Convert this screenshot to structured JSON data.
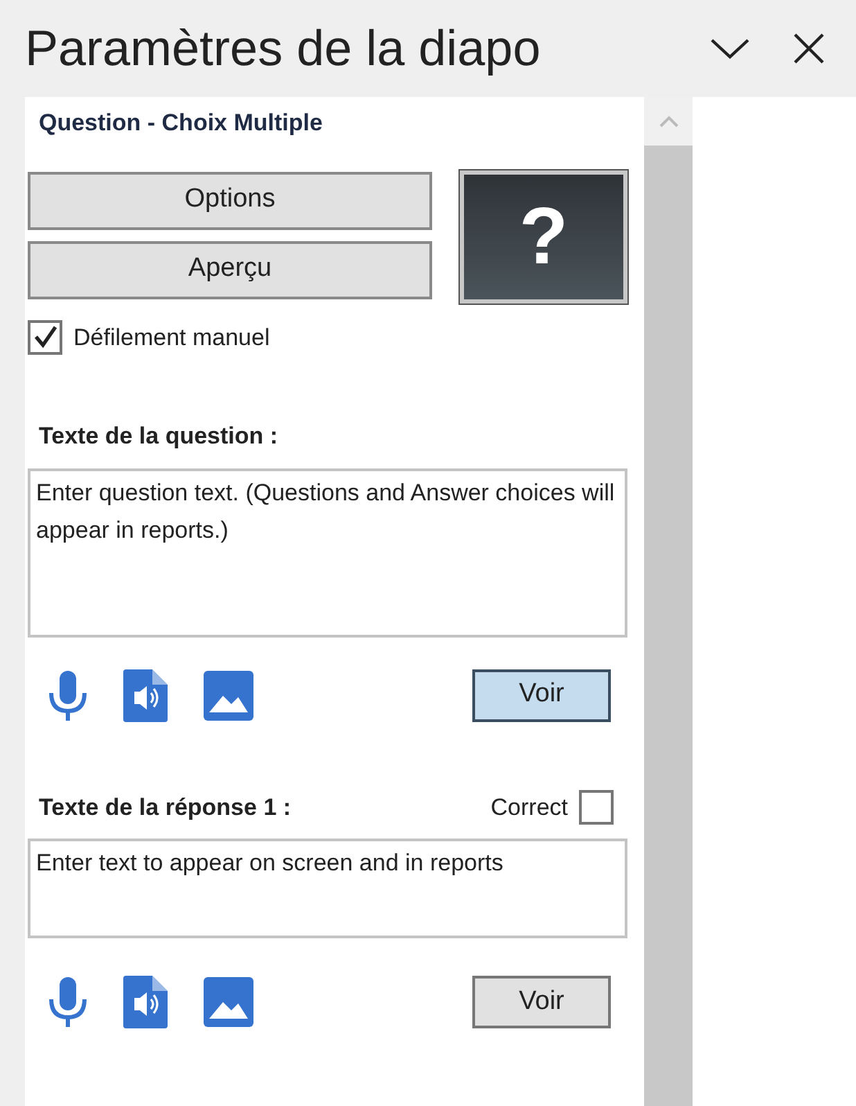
{
  "panel": {
    "title": "Paramètres de la diapo"
  },
  "slide_type": "Question - Choix Multiple",
  "buttons": [
    {
      "label": "Options"
    },
    {
      "label": "Aperçu"
    }
  ],
  "thumbnail_symbol": "?",
  "manual_scroll": {
    "label": "Défilement manuel",
    "checked": true
  },
  "question": {
    "label": "Texte de la question :",
    "text": "Enter question text. (Questions and Answer choices will appear in reports.)",
    "view_button": {
      "label": "Voir",
      "active": true
    }
  },
  "answers": [
    {
      "label": "Texte de la réponse 1 :",
      "correct_label": "Correct",
      "correct": false,
      "text": "Enter text to appear on screen and in reports",
      "view_button": {
        "label": "Voir",
        "active": false
      }
    }
  ]
}
